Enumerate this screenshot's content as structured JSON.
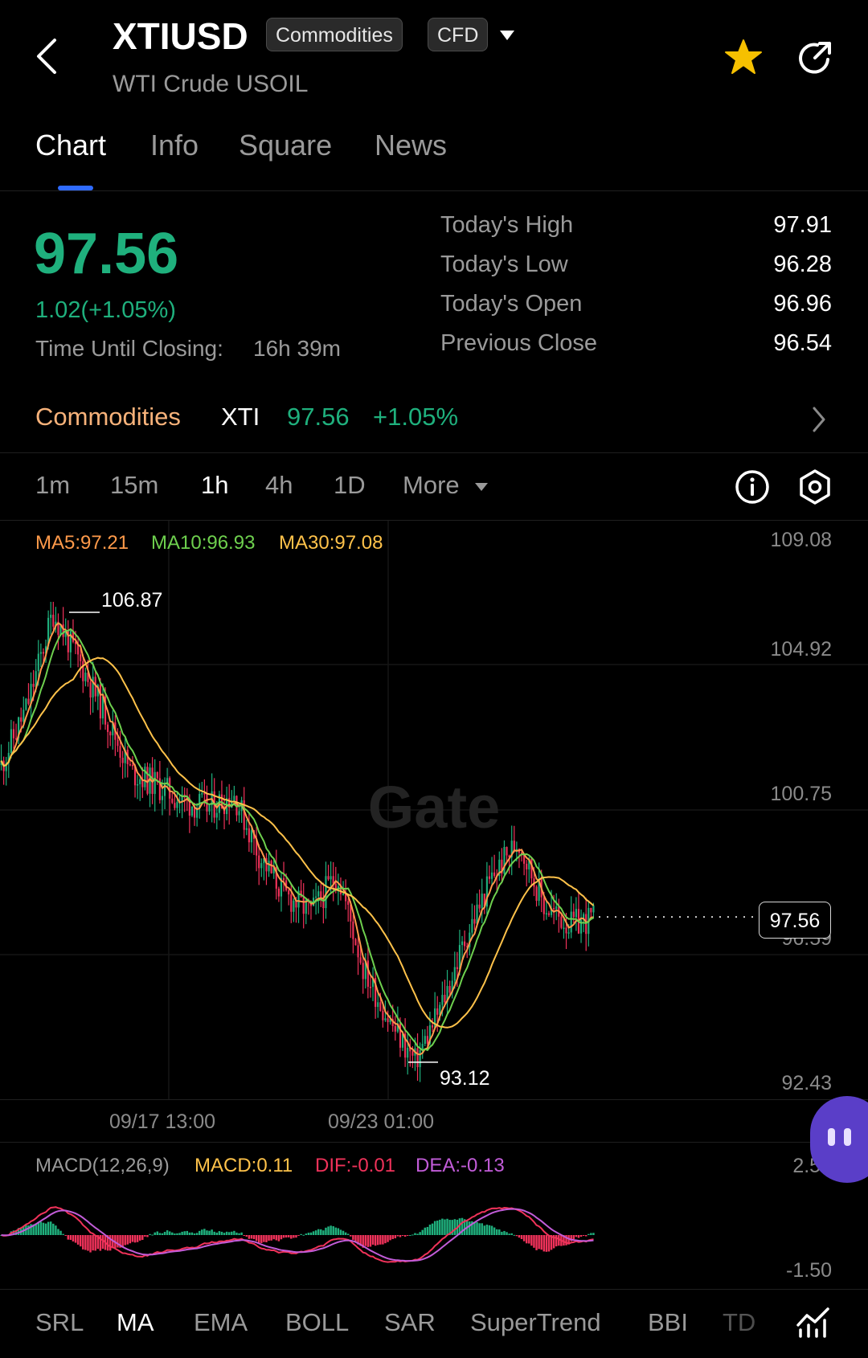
{
  "header": {
    "symbol": "XTIUSD",
    "tag1": "Commodities",
    "tag2": "CFD",
    "subtitle": "WTI Crude USOIL"
  },
  "tabs": [
    {
      "label": "Chart"
    },
    {
      "label": "Info"
    },
    {
      "label": "Square"
    },
    {
      "label": "News"
    }
  ],
  "price": {
    "last": "97.56",
    "change": "1.02(+1.05%)",
    "closing_label": "Time Until Closing:",
    "closing_value": "16h 39m"
  },
  "stats": [
    {
      "label": "Today's High",
      "value": "97.91"
    },
    {
      "label": "Today's Low",
      "value": "96.28"
    },
    {
      "label": "Today's Open",
      "value": "96.96"
    },
    {
      "label": "Previous Close",
      "value": "96.54"
    }
  ],
  "market_row": {
    "category": "Commodities",
    "ticker": "XTI",
    "price": "97.56",
    "change": "+1.05%"
  },
  "timeframes": [
    {
      "label": "1m"
    },
    {
      "label": "15m"
    },
    {
      "label": "1h"
    },
    {
      "label": "4h"
    },
    {
      "label": "1D"
    },
    {
      "label": "More"
    }
  ],
  "active_timeframe": "1h",
  "chart": {
    "watermark": "Gate",
    "ma5": "MA5:97.21",
    "ma10": "MA10:96.93",
    "ma30": "MA30:97.08",
    "y_ticks": [
      "109.08",
      "104.92",
      "100.75",
      "96.59",
      "92.43"
    ],
    "x_ticks": [
      "09/17 13:00",
      "09/23 01:00"
    ],
    "high_label": "106.87",
    "low_label": "93.12",
    "current_label": "97.56",
    "colors": {
      "up": "#1fb07d",
      "down": "#f0325a",
      "ma5": "#ff9a4a",
      "ma10": "#6ed04e",
      "ma30": "#ffc24a"
    }
  },
  "macd": {
    "name": "MACD(12,26,9)",
    "macd": "MACD:0.11",
    "dif": "DIF:-0.01",
    "dea": "DEA:-0.13",
    "top": "2.50",
    "bottom": "-1.50"
  },
  "indicators": [
    {
      "label": "SRL"
    },
    {
      "label": "MA"
    },
    {
      "label": "EMA"
    },
    {
      "label": "BOLL"
    },
    {
      "label": "SAR"
    },
    {
      "label": "SuperTrend"
    },
    {
      "label": "BBI"
    },
    {
      "label": "TD"
    }
  ],
  "active_indicator": "MA",
  "chart_data": {
    "type": "candlestick",
    "title": "",
    "y_ticks": [
      109.08,
      104.92,
      100.75,
      96.59,
      92.43
    ],
    "ylim": [
      92.43,
      109.08
    ],
    "x_ticks": [
      "09/17 13:00",
      "09/23 01:00"
    ],
    "series": [
      {
        "name": "MA5",
        "last": 97.21
      },
      {
        "name": "MA10",
        "last": 96.93
      },
      {
        "name": "MA30",
        "last": 97.08
      }
    ],
    "trend": [
      102.2,
      104.0,
      106.87,
      105.4,
      103.8,
      102.0,
      101.6,
      101.1,
      100.9,
      101.3,
      99.4,
      98.2,
      97.7,
      98.9,
      96.0,
      94.4,
      93.12,
      94.8,
      97.0,
      98.8,
      99.9,
      97.9,
      97.3,
      97.56
    ],
    "high": 106.87,
    "low": 93.12,
    "last": 97.56,
    "grid": true
  }
}
